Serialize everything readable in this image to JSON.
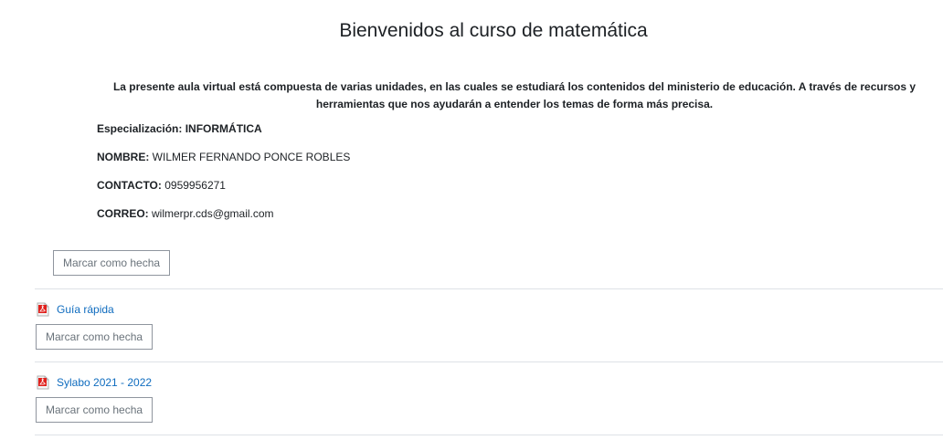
{
  "course": {
    "title": "Bienvenidos al curso de matemática",
    "intro": "La presente aula virtual está compuesta de varias unidades, en las cuales se estudiará los contenidos del ministerio de educación. A través de recursos y herramientas que nos ayudarán a entender los temas de forma más precisa."
  },
  "info": {
    "specialization_label": "Especialización:",
    "specialization_value": "INFORMÁTICA",
    "name_label": "NOMBRE:",
    "name_value": "WILMER FERNANDO PONCE ROBLES",
    "contact_label": "CONTACTO:",
    "contact_value": "0959956271",
    "email_label": "CORREO:",
    "email_value": "wilmerpr.cds@gmail.com"
  },
  "completion": {
    "mark_done_label": "Marcar como hecha"
  },
  "resources": [
    {
      "name": "Guía rápida",
      "icon": "pdf-icon"
    },
    {
      "name": "Sylabo 2021 - 2022",
      "icon": "pdf-icon"
    }
  ],
  "colors": {
    "link": "#0f6cbf",
    "pdf_red": "#e0201c",
    "divider": "#dee2e6"
  }
}
